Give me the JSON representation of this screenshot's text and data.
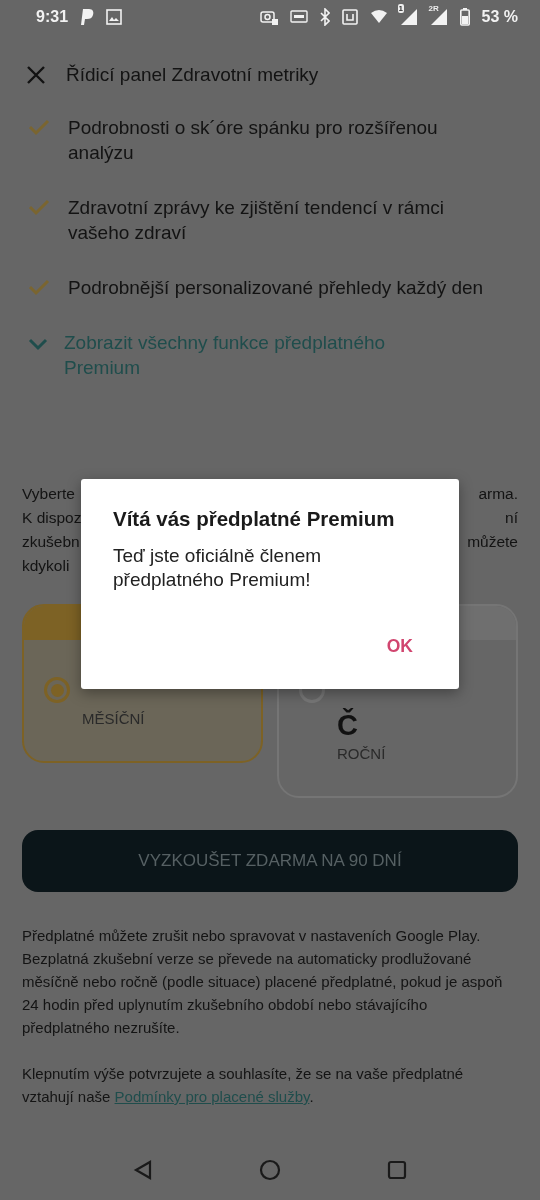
{
  "status_bar": {
    "time": "9:31",
    "sim_labels": [
      "1",
      "2R"
    ],
    "battery": "53 %"
  },
  "header": {
    "title": "Řídicí panel Zdravotní metriky"
  },
  "features": [
    {
      "text": "Podrobnosti o sk´óre spánku pro rozšířenou analýzu"
    },
    {
      "text": "Zdravotní zprávy ke zjištění tendencí v rámci vašeho zdraví"
    },
    {
      "text": "Podrobnější personalizované přehledy každý den"
    }
  ],
  "show_all": {
    "label": "Zobrazit všechny funkce předplatného Premium",
    "expanded": false
  },
  "intro_fragments": [
    {
      "left": "Vyberte",
      "right": "arma."
    },
    {
      "left": "K dispoz",
      "right": "ní"
    },
    {
      "left": "zkušebn",
      "right": "můžete"
    },
    {
      "left": "kdykoli"
    }
  ],
  "plans": [
    {
      "period": "MĚSÍČNÍ",
      "selected": true
    },
    {
      "price": "Č",
      "period": "ROČNÍ",
      "selected": false
    }
  ],
  "cta": "VYZKOUŠET ZDARMA NA 90 DNÍ",
  "legal": [
    {
      "text": "Předplatné můžete zrušit nebo spravovat v nastaveních Google Play. Bezplatná zkušební verze se převede na automaticky prodlužované měsíčně nebo ročně (podle situace) placené předplatné, pokud je aspoň 24 hodin před uplynutím zkušebního období nebo stávajícího předplatného nezrušíte."
    },
    {
      "text": "Klepnutím výše potvrzujete a souhlasíte, že se na vaše předplatné vztahují naše ",
      "link": "Podmínky pro placené služby",
      "after": "."
    }
  ],
  "dialog": {
    "title": "Vítá vás předplatné Premium",
    "message": "Teď jste oficiálně členem předplatného Premium!",
    "button": "OK"
  }
}
